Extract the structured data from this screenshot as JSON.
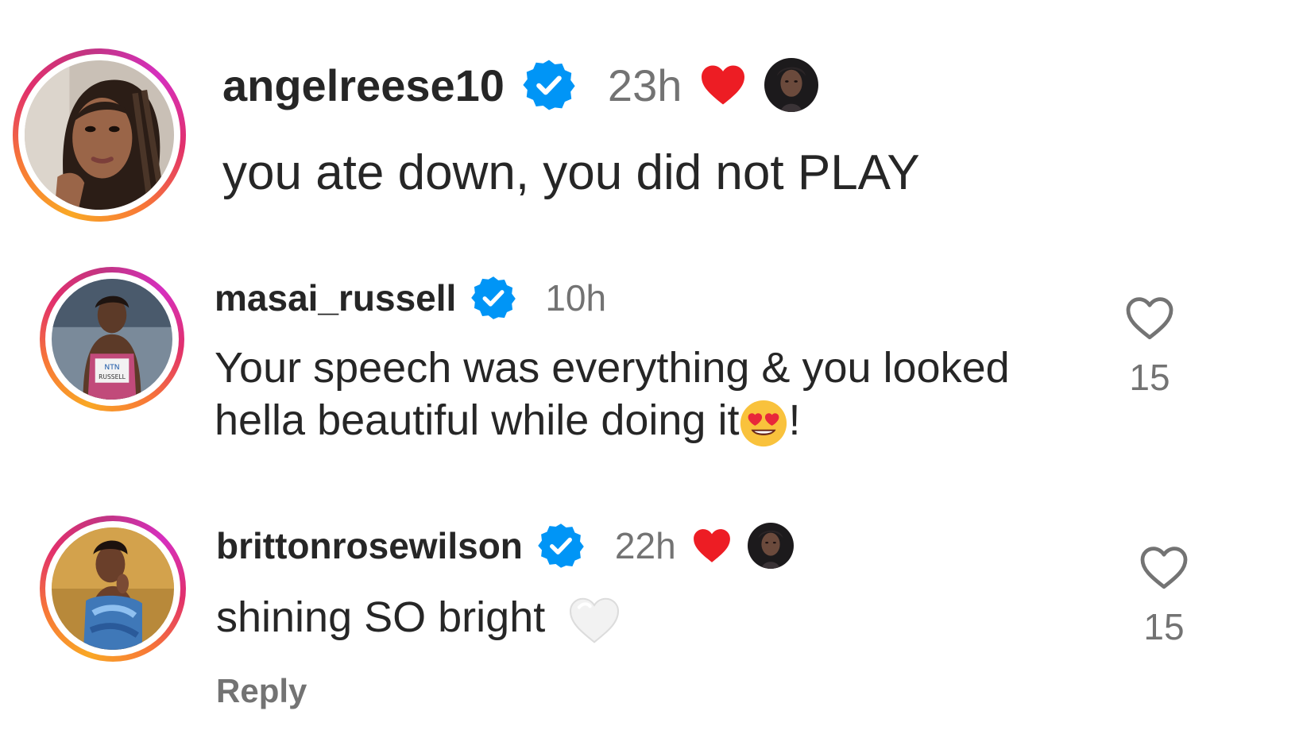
{
  "colors": {
    "verified_blue": "#0095f6",
    "heart_red": "#ed1d24",
    "text_primary": "#262626",
    "text_secondary": "#737373"
  },
  "comments": [
    {
      "username": "angelreese10",
      "verified": true,
      "time": "23h",
      "liked_by_creator": true,
      "text": "you ate down, you did not PLAY",
      "icons": [
        "verified-badge-icon",
        "heart-filled-icon",
        "creator-avatar"
      ]
    },
    {
      "username": "masai_russell",
      "verified": true,
      "time": "10h",
      "liked_by_creator": false,
      "text_line1": "Your speech was everything & you looked",
      "text_line2_before": "hella beautiful while doing it",
      "text_line2_emoji": "heart-eyes-emoji",
      "text_line2_after": "!",
      "like_count": "15",
      "icons": [
        "verified-badge-icon",
        "heart-outline-icon",
        "heart-eyes-emoji"
      ]
    },
    {
      "username": "brittonrosewilson",
      "verified": true,
      "time": "22h",
      "liked_by_creator": true,
      "text": "shining SO bright",
      "text_emoji": "white-heart-emoji",
      "like_count": "15",
      "reply_label": "Reply",
      "icons": [
        "verified-badge-icon",
        "heart-filled-icon",
        "creator-avatar",
        "heart-outline-icon",
        "white-heart-emoji"
      ]
    }
  ]
}
